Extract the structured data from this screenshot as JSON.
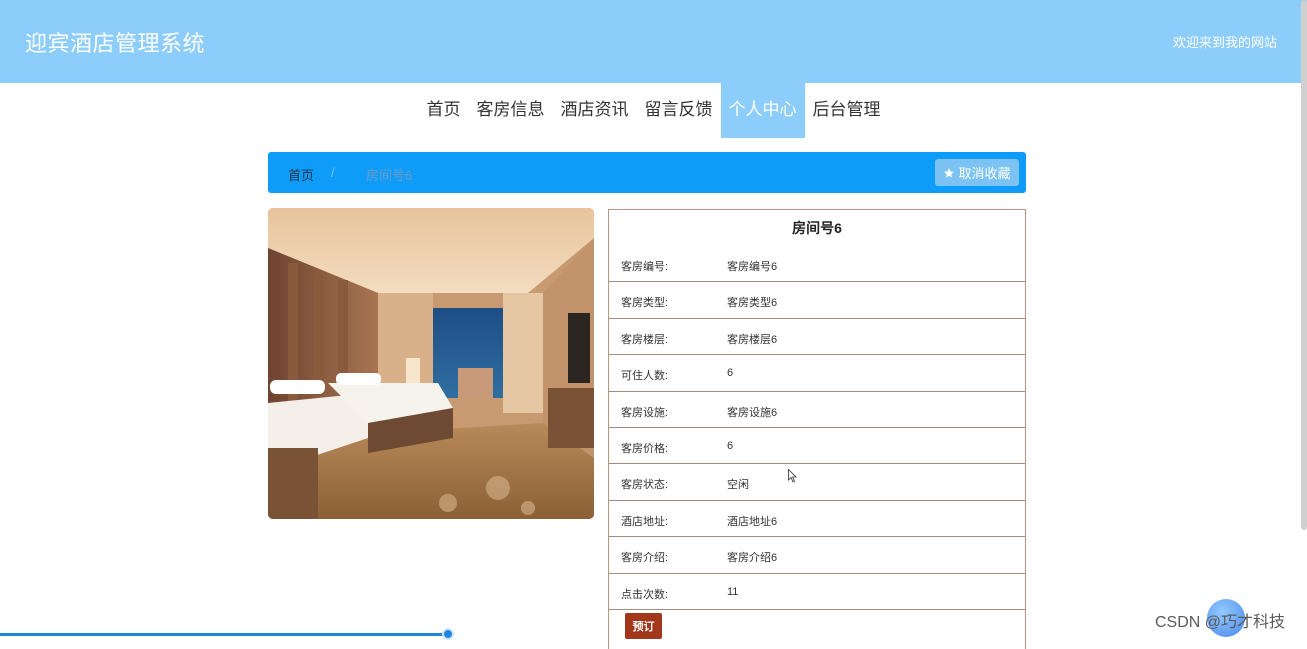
{
  "header": {
    "site_title": "迎宾酒店管理系统",
    "welcome": "欢迎来到我的网站"
  },
  "nav": [
    "首页",
    "客房信息",
    "酒店资讯",
    "留言反馈",
    "个人中心",
    "后台管理"
  ],
  "nav_active_index": 4,
  "breadcrumb": {
    "home": "首页",
    "separator": "/",
    "current": "房间号6"
  },
  "unfavorite_button": "取消收藏",
  "detail": {
    "title": "房间号6",
    "rows": [
      {
        "label": "客房编号:",
        "value": "客房编号6"
      },
      {
        "label": "客房类型:",
        "value": "客房类型6"
      },
      {
        "label": "客房楼层:",
        "value": "客房楼层6"
      },
      {
        "label": "可住人数:",
        "value": "6"
      },
      {
        "label": "客房设施:",
        "value": "客房设施6"
      },
      {
        "label": "客房价格:",
        "value": "6"
      },
      {
        "label": "客房状态:",
        "value": "空闲"
      },
      {
        "label": "酒店地址:",
        "value": "酒店地址6"
      },
      {
        "label": "客房介绍:",
        "value": "客房介绍6"
      },
      {
        "label": "点击次数:",
        "value": "11"
      }
    ],
    "book_button": "预订"
  },
  "watermark": "CSDN @巧才科技",
  "colors": {
    "header": "#8dcdfb",
    "breadcrumb_bar": "#0e9cf8",
    "book_button": "#a2371b"
  }
}
